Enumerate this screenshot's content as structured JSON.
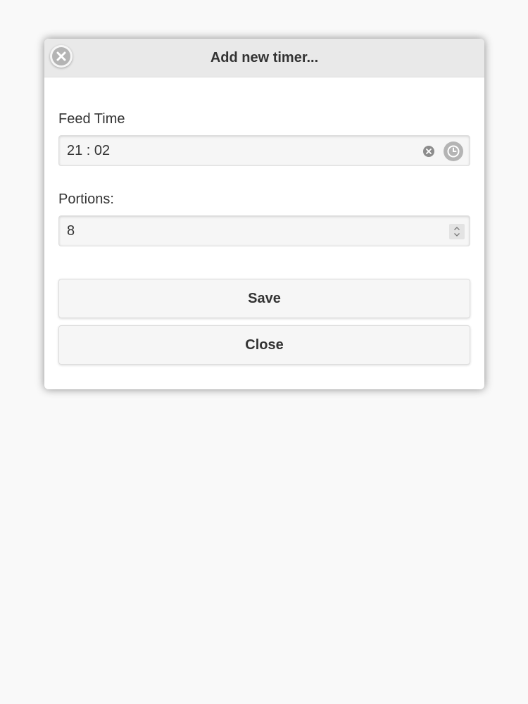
{
  "dialog": {
    "title": "Add new timer...",
    "close_icon": "close-circle-icon"
  },
  "feed_time": {
    "label": "Feed Time",
    "value": "21 : 02",
    "clear_icon": "clear-icon",
    "picker_icon": "clock-icon"
  },
  "portions": {
    "label": "Portions:",
    "value": "8",
    "spinner_icon": "spinner-icon"
  },
  "buttons": {
    "save_label": "Save",
    "close_label": "Close"
  }
}
